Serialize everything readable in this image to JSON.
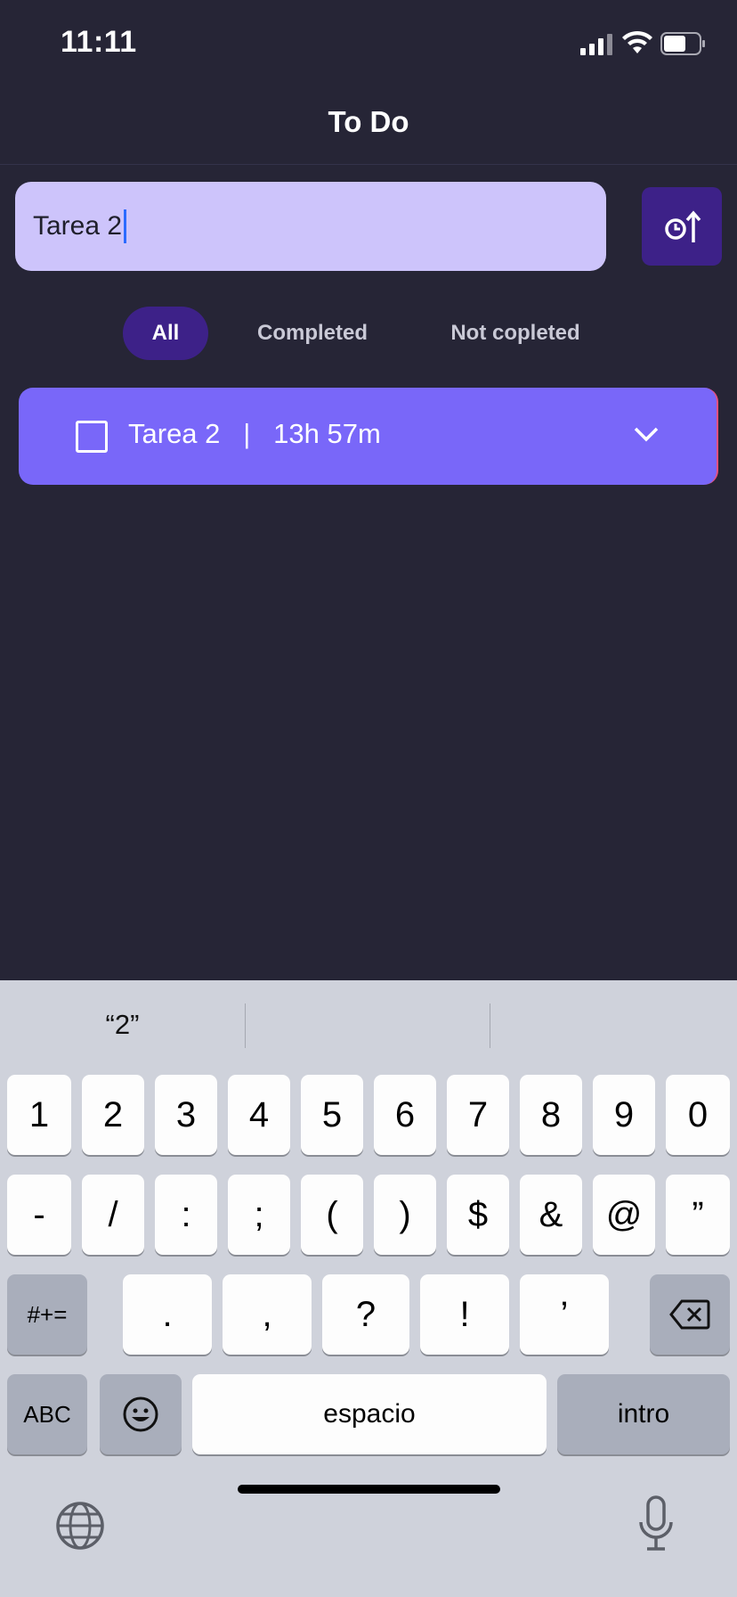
{
  "status_bar": {
    "time": "11:11"
  },
  "header": {
    "title": "To Do"
  },
  "task_input": {
    "value": "Tarea 2"
  },
  "sort_button": {
    "icon": "clock-sort-icon"
  },
  "filters": [
    {
      "label": "All",
      "active": true
    },
    {
      "label": "Completed",
      "active": false
    },
    {
      "label": "Not copleted",
      "active": false
    }
  ],
  "tasks": [
    {
      "title": "Tarea 2",
      "separator": "|",
      "time": "13h 57m",
      "completed": false
    }
  ],
  "keyboard": {
    "suggestions": [
      "“2”",
      "",
      ""
    ],
    "row1": [
      "1",
      "2",
      "3",
      "4",
      "5",
      "6",
      "7",
      "8",
      "9",
      "0"
    ],
    "row2": [
      "-",
      "/",
      ":",
      ";",
      "(",
      ")",
      "$",
      "&",
      "@",
      "”"
    ],
    "row3": [
      ".",
      ",",
      "?",
      "!",
      "’"
    ],
    "symbols_key": "#+=",
    "abc_key": "ABC",
    "space_key": "espacio",
    "return_key": "intro"
  },
  "colors": {
    "background": "#262536",
    "input_bg": "#cdc4fb",
    "accent_dark": "#3d2188",
    "task_card": "#7967f9",
    "keyboard_bg": "#cfd2db"
  }
}
